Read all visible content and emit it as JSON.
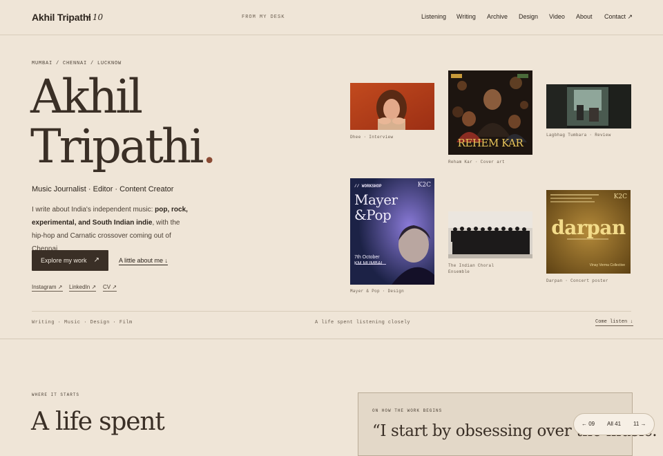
{
  "header": {
    "brand": "Akhil Tripathi",
    "brand_number": "/ 10",
    "tagline": "FROM MY DESK",
    "nav": [
      {
        "label": "Listening"
      },
      {
        "label": "Writing"
      },
      {
        "label": "Archive"
      },
      {
        "label": "Design"
      },
      {
        "label": "Video"
      },
      {
        "label": "About"
      },
      {
        "label": "Contact ↗"
      }
    ]
  },
  "hero": {
    "cities": "MUMBAI / CHENNAI / LUCKNOW",
    "name_line1": "Akhil",
    "name_line2": "Tripathi",
    "name_dot": ".",
    "tagline": "Music Journalist · Editor · Content Creator",
    "intro_pre": "I write about India's independent music: ",
    "intro_bold": "pop, rock, experimental, and South Indian indie",
    "intro_post": ", with the hip-hop and Carnatic crossover coming out of Chennai.",
    "primary_button": "Explore my work",
    "primary_button_icon": "↗",
    "secondary_link": "A little about me ↓",
    "social": [
      "Instagram ↗",
      "LinkedIn ↗",
      "CV ↗"
    ]
  },
  "gallery": [
    {
      "caption": "Dhee · Interview",
      "icon": "portrait-photo"
    },
    {
      "caption": "Reham Kar · Cover art",
      "title": "REHEM KAR",
      "icon": "album-cover"
    },
    {
      "caption": "Lagbhag Tumbara · Review",
      "icon": "street-photo"
    },
    {
      "caption": "Mayer & Pop · Design",
      "badge": "// WORKSHOP",
      "title_line1": "Mayer",
      "title_line2": "&Pop",
      "date_line1": "7th October",
      "date_line2": "KM MUMBAI",
      "logo": "K2C"
    },
    {
      "caption_line1": "The Indian Choral",
      "caption_line2": "Ensemble",
      "icon": "choir-photo"
    },
    {
      "caption": "Darpan · Concert poster",
      "title": "darpan",
      "logo": "K2C",
      "footer": "Vinay Verma Collective"
    }
  ],
  "strip": {
    "left": "Writing · Music · Design · Film",
    "center": "A life spent listening closely",
    "right": "Come listen ↓"
  },
  "section2": {
    "eyebrow": "WHERE IT STARTS",
    "heading": "A life spent",
    "quote_eyebrow": "ON HOW THE WORK BEGINS",
    "quote": "“I start by obsessing over the music."
  },
  "pager": {
    "prev": "← 09",
    "all": "All 41",
    "next": "11 →"
  },
  "colors": {
    "background": "#efe5d7",
    "ink": "#2c241d",
    "accent": "#8a4a33",
    "button": "#3a2f26"
  }
}
